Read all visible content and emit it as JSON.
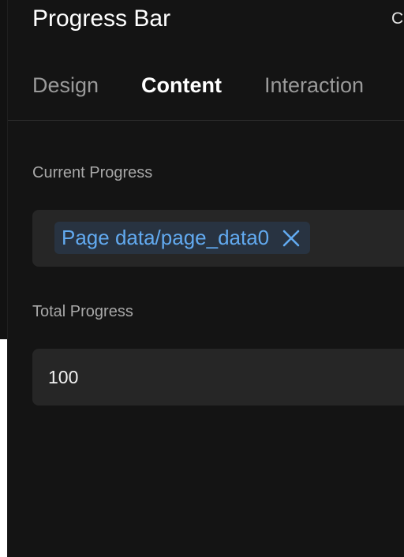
{
  "panel": {
    "title": "Progress Bar",
    "header_action_label": "C"
  },
  "tabs": [
    {
      "label": "Design",
      "active": false
    },
    {
      "label": "Content",
      "active": true
    },
    {
      "label": "Interaction",
      "active": false
    }
  ],
  "fields": {
    "current_progress": {
      "label": "Current Progress",
      "binding_chip": "Page data/page_data0",
      "remove_icon": "close-icon"
    },
    "total_progress": {
      "label": "Total Progress",
      "value": "100"
    }
  },
  "colors": {
    "panel_background": "#141414",
    "field_background": "#262626",
    "chip_background": "#283341",
    "chip_text": "#62aaf0",
    "active_tab": "#ffffff",
    "inactive_tab": "#9a9a9a"
  }
}
